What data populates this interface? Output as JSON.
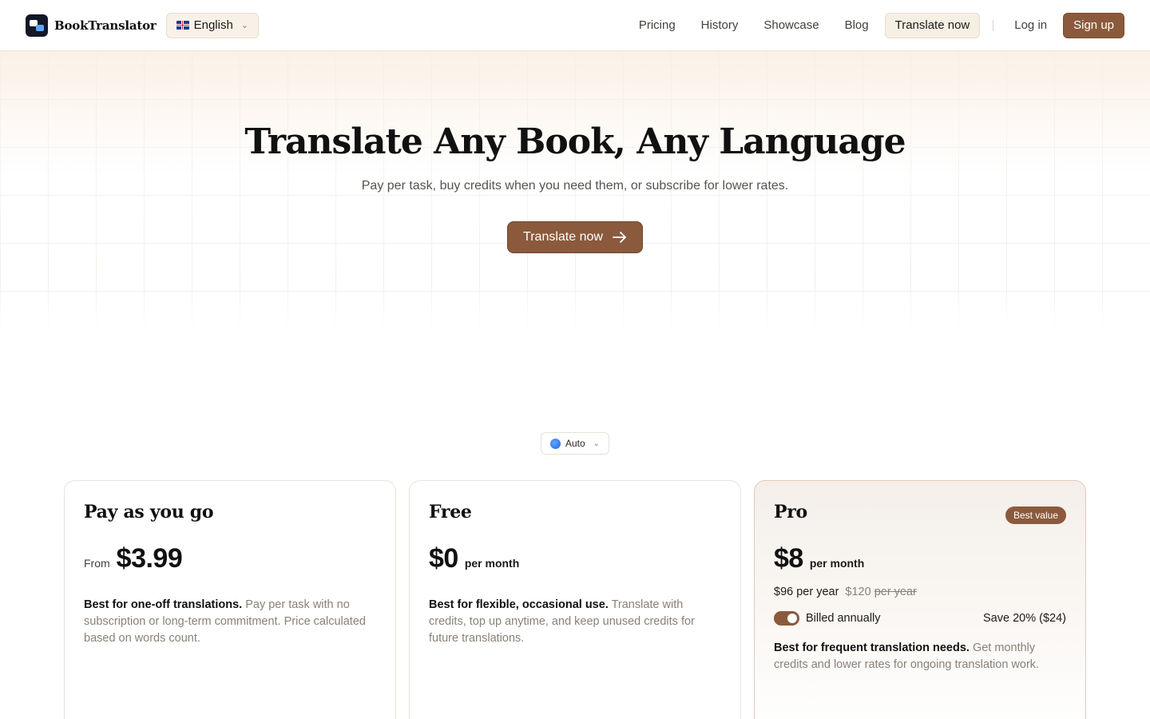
{
  "header": {
    "brand": "BookTranslator",
    "language": "English",
    "nav": [
      "Pricing",
      "History",
      "Showcase",
      "Blog"
    ],
    "cta": "Translate now",
    "login": "Log in",
    "signup": "Sign up"
  },
  "hero": {
    "title": "Translate Any Book, Any Language",
    "subtitle": "Pay per task, buy credits when you need them, or subscribe for lower rates.",
    "button": "Translate now"
  },
  "currency": {
    "value": "Auto"
  },
  "plans": [
    {
      "title": "Pay as you go",
      "price_prefix": "From",
      "price": "$3.99",
      "desc_strong": "Best for one-off translations.",
      "desc": " Pay per task with no subscription or long-term commitment. Price calculated based on words count."
    },
    {
      "title": "Free",
      "price": "$0",
      "price_suffix": "per month",
      "desc_strong": "Best for flexible, occasional use.",
      "desc": " Translate with credits, top up anytime, and keep unused credits for future translations."
    },
    {
      "title": "Pro",
      "badge": "Best value",
      "price": "$8",
      "price_suffix": "per month",
      "yearly": "$96 per year",
      "yearly_old": "$120",
      "yearly_old_suffix": "per year",
      "billing_label": "Billed annually",
      "billed_annually": true,
      "save": "Save 20% ($24)",
      "desc_strong": "Best for frequent translation needs.",
      "desc": " Get monthly credits and lower rates for ongoing translation work."
    }
  ],
  "colors": {
    "accent": "#8b5a3c",
    "accent_soft": "#f6efe4"
  }
}
